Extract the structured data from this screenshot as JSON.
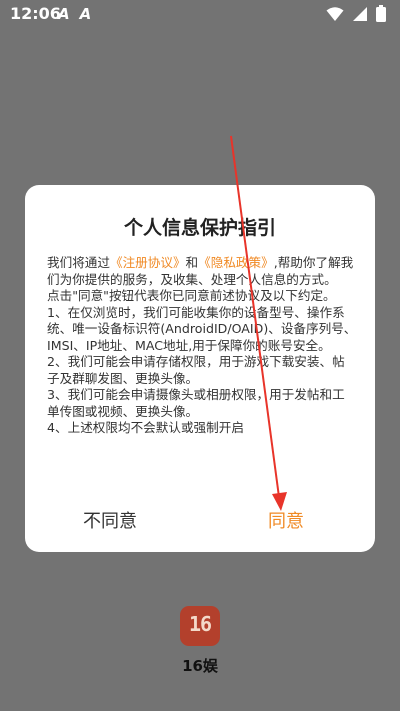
{
  "status_bar": {
    "time": "12:06",
    "app_icons": [
      "A",
      "A"
    ]
  },
  "dialog": {
    "title": "个人信息保护指引",
    "body": {
      "p1_prefix": "我们将通过",
      "link1": "《注册协议》",
      "p1_mid": "和",
      "link2": "《隐私政策》",
      "p1_suffix": ",帮助你了解我们为你提供的服务，及收集、处理个人信息的方式。",
      "p2": "点击\"同意\"按钮代表你已同意前述协议及以下约定。",
      "p3": "1、在仅浏览时，我们可能收集你的设备型号、操作系统、唯一设备标识符(AndroidID/OAID)、设备序列号、IMSI、IP地址、MAC地址,用于保障你的账号安全。",
      "p4": "2、我们可能会申请存储权限，用于游戏下载安装、帖子及群聊发图、更换头像。",
      "p5": "3、我们可能会申请摄像头或相册权限，用于发帖和工单传图或视频、更换头像。",
      "p6": "4、上述权限均不会默认或强制开启"
    },
    "disagree_label": "不同意",
    "agree_label": "同意"
  },
  "app": {
    "logo_text": "16",
    "name": "16娱"
  },
  "colors": {
    "accent": "#f08a25",
    "arrow": "#e8342a",
    "logo_bg": "#b3402c"
  }
}
